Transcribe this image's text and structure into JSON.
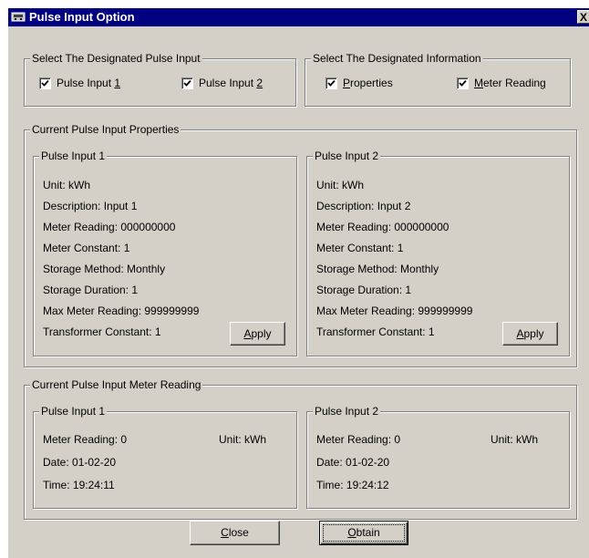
{
  "window": {
    "title": "Pulse Input Option",
    "close_glyph": "X"
  },
  "select_input": {
    "label": "Select The Designated Pulse Input",
    "items": [
      {
        "pre": "Pulse Input ",
        "mn": "1",
        "post": "",
        "checked": true
      },
      {
        "pre": "Pulse Input ",
        "mn": "2",
        "post": "",
        "checked": true
      }
    ]
  },
  "select_info": {
    "label": "Select The Designated Information",
    "items": [
      {
        "pre": "",
        "mn": "P",
        "post": "roperties",
        "checked": true
      },
      {
        "pre": "",
        "mn": "M",
        "post": "eter Reading",
        "checked": true
      }
    ]
  },
  "properties": {
    "label": "Current Pulse Input Properties",
    "inputs": [
      {
        "label": "Pulse Input 1",
        "lines": [
          "Unit: kWh",
          "Description: Input 1",
          "Meter Reading: 000000000",
          "Meter Constant: 1",
          "Storage Method: Monthly",
          "Storage Duration: 1",
          "Max Meter Reading: 999999999",
          "Transformer Constant: 1"
        ],
        "apply_mn": "A",
        "apply_rest": "pply"
      },
      {
        "label": "Pulse Input 2",
        "lines": [
          "Unit: kWh",
          "Description: Input 2",
          "Meter Reading: 000000000",
          "Meter Constant: 1",
          "Storage Method: Monthly",
          "Storage Duration: 1",
          "Max Meter Reading: 999999999",
          "Transformer Constant: 1"
        ],
        "apply_mn": "A",
        "apply_rest": "pply"
      }
    ]
  },
  "readings": {
    "label": "Current Pulse Input Meter Reading",
    "inputs": [
      {
        "label": "Pulse Input 1",
        "meter": "Meter Reading: 0",
        "unit": "Unit: kWh",
        "date": "Date: 01-02-20",
        "time": "Time: 19:24:11"
      },
      {
        "label": "Pulse Input 2",
        "meter": "Meter Reading: 0",
        "unit": "Unit: kWh",
        "date": "Date: 01-02-20",
        "time": "Time: 19:24:12"
      }
    ]
  },
  "buttons": {
    "close_mn": "C",
    "close_rest": "lose",
    "obtain_mn": "O",
    "obtain_rest": "btain"
  },
  "colors": {
    "title_bar": "#000080",
    "face": "#d4d0c8"
  },
  "icons": {
    "app": "meter-app-icon",
    "check": "checkmark-icon"
  }
}
